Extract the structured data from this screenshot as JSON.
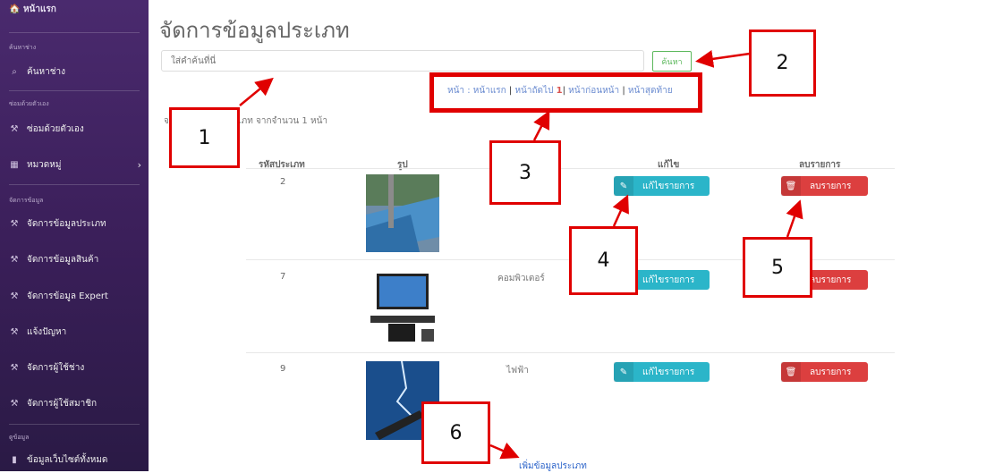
{
  "sidebar": {
    "home": "หน้าแรก",
    "section1": "ค้นหาช่าง",
    "search_tech": "ค้นหาช่าง",
    "section2": "ซ่อมด้วยตัวเอง",
    "diy": "ซ่อมด้วยตัวเอง",
    "category": "หมวดหมู่",
    "section3": "จัดการข้อมูล",
    "items": [
      {
        "label": "จัดการข้อมูลประเภท"
      },
      {
        "label": "จัดการข้อมูลสินค้า"
      },
      {
        "label": "จัดการข้อมูล Expert"
      },
      {
        "label": "แจ้งปัญหา"
      },
      {
        "label": "จัดการผู้ใช้ช่าง"
      },
      {
        "label": "จัดการผู้ใช้สมาชิก"
      }
    ],
    "section4": "ดูข้อมูล",
    "all_web": "ข้อมูลเว็บไซต์ทั้งหมด"
  },
  "page": {
    "title": "จัดการข้อมูลประเภท"
  },
  "search": {
    "placeholder": "ใส่คำค้นที่นี่",
    "button": "ค้นหา"
  },
  "pager": {
    "label": "หน้า :",
    "first": "หน้าแรก",
    "next": "หน้าถัดไป",
    "current": "1",
    "prev": "หน้าก่อนหน้า",
    "last": "หน้าสุดท้าย"
  },
  "summary": {
    "text": "จ ภทท้งหมด 4 ประเภท จากจำนวน 1 หน้า"
  },
  "table": {
    "headers": {
      "id": "รหัสประเภท",
      "image": "รูป",
      "edit": "แก้ไข",
      "delete": "ลบรายการ"
    },
    "rows": [
      {
        "id": "2",
        "name": "",
        "image_icon": "photo-fabric-icon"
      },
      {
        "id": "7",
        "name": "คอมพิวเตอร์",
        "image_icon": "photo-computer-icon"
      },
      {
        "id": "9",
        "name": "ไฟฟ้า",
        "image_icon": "photo-electric-icon"
      }
    ],
    "edit_label": "แก้ไขรายการ",
    "delete_label": "ลบรายการ"
  },
  "add_link": "เพิ่มข้อมูลประเภท",
  "callouts": [
    "1",
    "2",
    "3",
    "4",
    "5",
    "6"
  ],
  "colors": {
    "sidebar": "#3b1f5a",
    "edit": "#2bb5c9",
    "delete": "#dc3f3f",
    "search_btn": "#5cb85c",
    "callout": "#e00000"
  }
}
